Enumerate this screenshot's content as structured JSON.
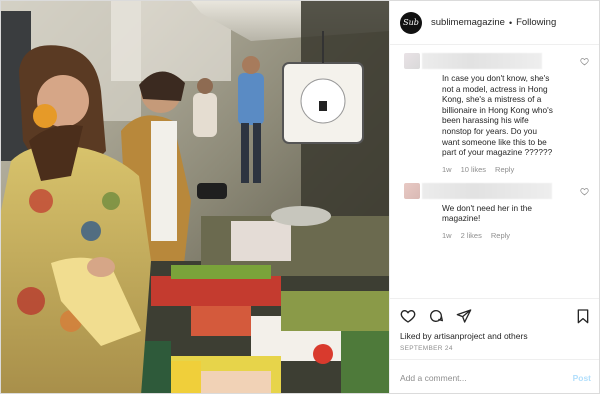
{
  "header": {
    "avatar_text": "Sub",
    "username": "sublimemagazine",
    "separator": "•",
    "follow_label": "Following"
  },
  "comments": [
    {
      "text": "In case you don't know, she's not a model, actress in Hong Kong, she's a mistress of a billionaire in Hong Kong who's been harassing his wife nonstop for years. Do you want someone like this to be part of your magazine ??????",
      "time": "1w",
      "likes": "10 likes",
      "reply_label": "Reply"
    },
    {
      "text": "We don't need her in the magazine!",
      "time": "1w",
      "likes": "2 likes",
      "reply_label": "Reply"
    }
  ],
  "actions": {
    "icons": [
      "heart-icon",
      "comment-icon",
      "share-icon",
      "bookmark-icon"
    ],
    "likes_text": "Liked by artisanproject and others",
    "date": "SEPTEMBER 24"
  },
  "add_comment": {
    "placeholder": "Add a comment...",
    "post_label": "Post"
  },
  "colors": {
    "post_disabled": "#b2dffc",
    "muted": "#8e8e8e",
    "text": "#262626"
  }
}
